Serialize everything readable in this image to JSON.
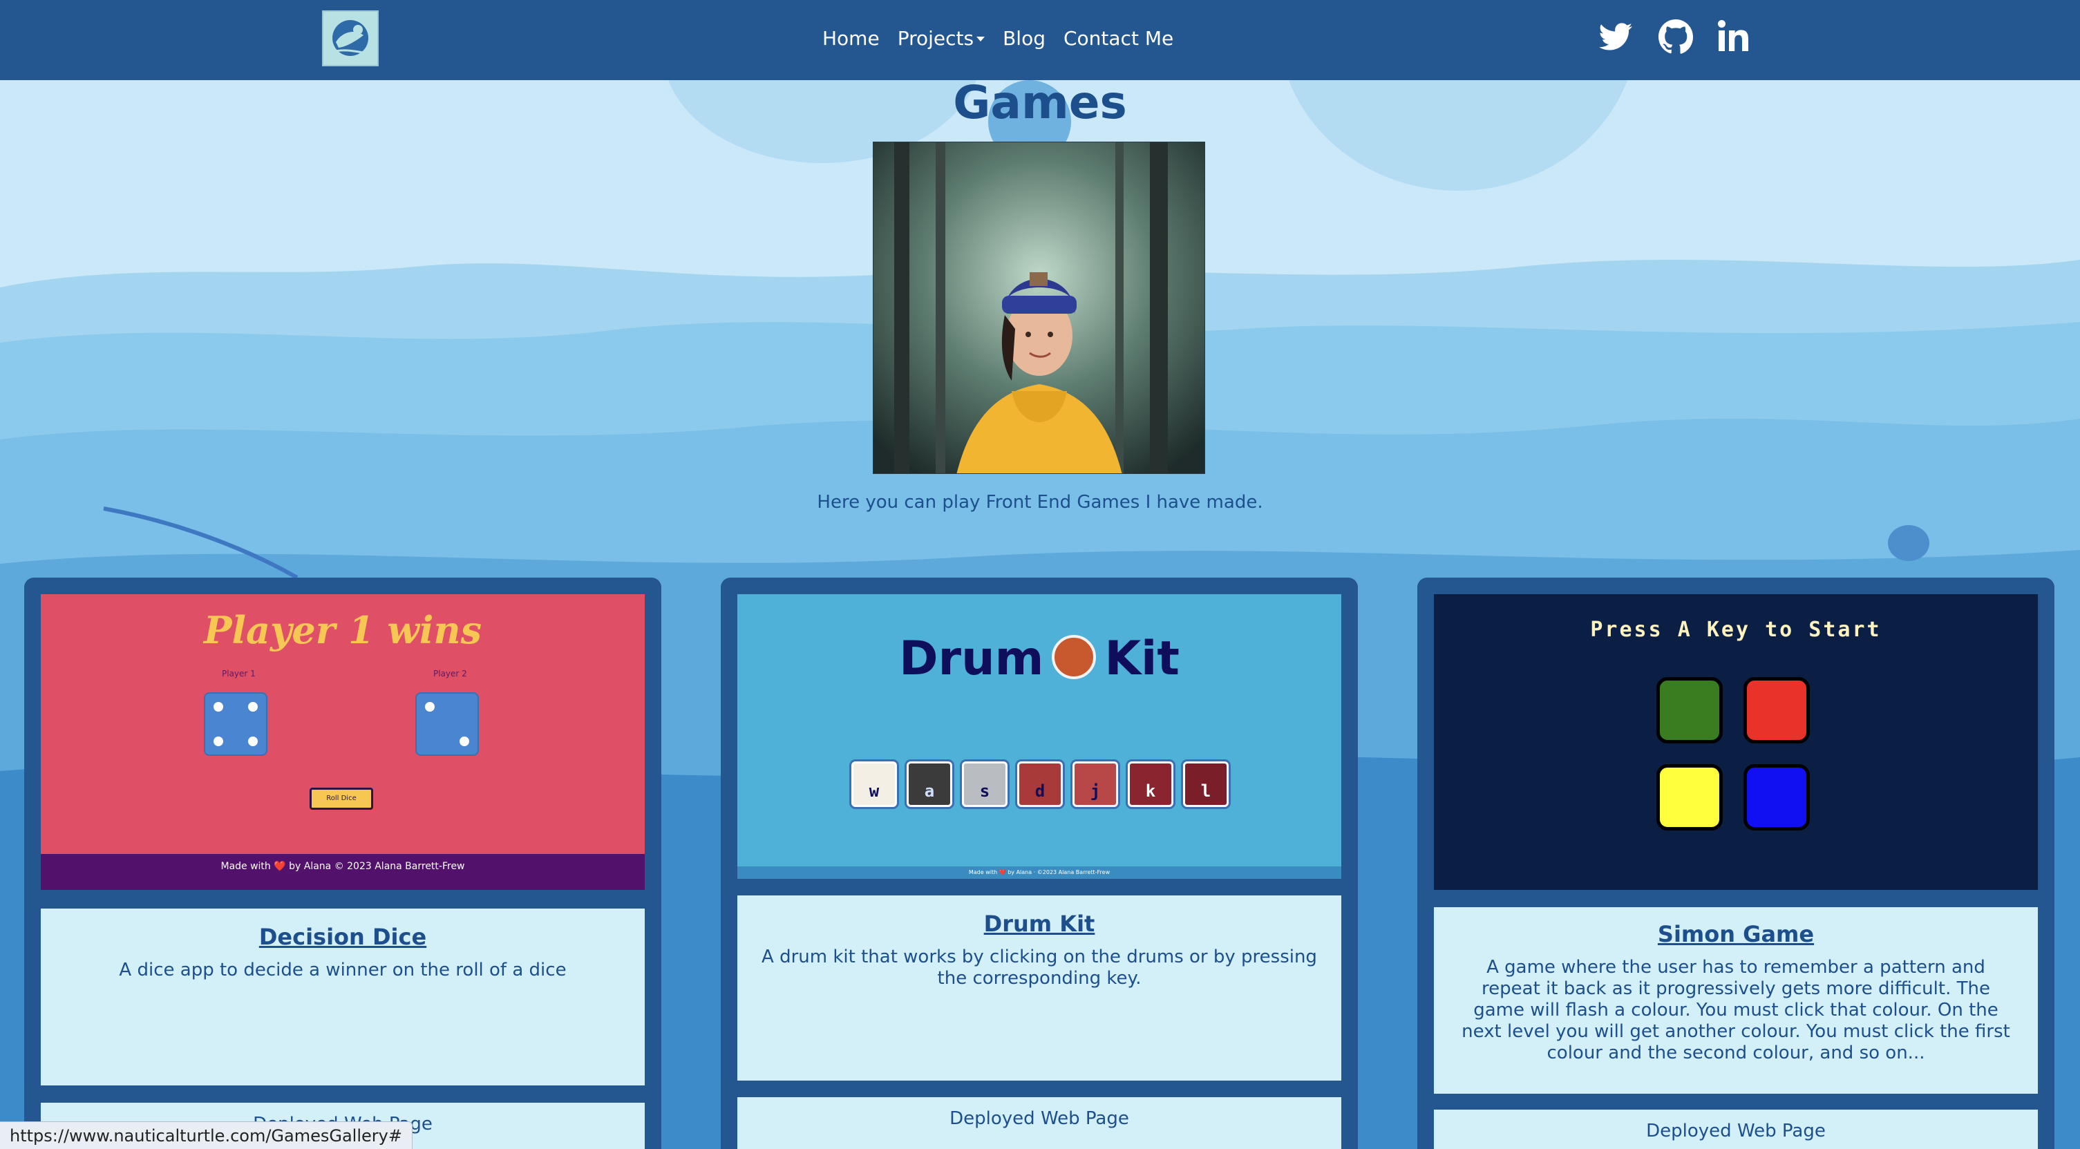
{
  "navbar": {
    "links": [
      "Home",
      "Projects",
      "Blog",
      "Contact Me"
    ]
  },
  "social": {
    "icons": [
      "twitter-icon",
      "github-icon",
      "linkedin-icon"
    ]
  },
  "header": {
    "title": "Games",
    "intro": "Here you can play Front End Games I have made."
  },
  "cards": [
    {
      "title": "Decision Dice",
      "description": "A dice app to decide a winner on the roll of a dice",
      "footer": "Deployed Web Page",
      "screenshot": {
        "heading": "Player 1 wins",
        "player1": "Player 1",
        "player2": "Player 2",
        "button": "Roll Dice",
        "footer": "Made with ❤️ by Alana © 2023 Alana Barrett-Frew"
      }
    },
    {
      "title": "Drum Kit",
      "description": "A drum kit that works by clicking on the drums or by pressing the corresponding key.",
      "footer": "Deployed Web Page",
      "screenshot": {
        "heading_left": "Drum",
        "heading_right": "Kit",
        "keys": [
          "w",
          "a",
          "s",
          "d",
          "j",
          "k",
          "l"
        ],
        "footer": "Made with ❤️ by Alana · ©2023 Alana Barrett-Frew"
      }
    },
    {
      "title": "Simon Game",
      "description": "A game where the user has to remember a pattern and repeat it back as it progressively gets more difficult. The game will flash a colour. You must click that colour. On the next level you will get another colour. You must click the first colour and the second colour, and so on...",
      "footer": "Deployed Web Page",
      "screenshot": {
        "heading": "Press A Key to Start"
      }
    }
  ],
  "status_bar": {
    "url": "https://www.nauticalturtle.com/GamesGallery#"
  },
  "colors": {
    "navbar": "#24568f",
    "text": "#1d4f8c",
    "card_body": "#d3eff8",
    "simon_green": "#3a7d20",
    "simon_red": "#e8322a",
    "simon_yellow": "#ffff3d",
    "simon_blue": "#1010f2"
  }
}
